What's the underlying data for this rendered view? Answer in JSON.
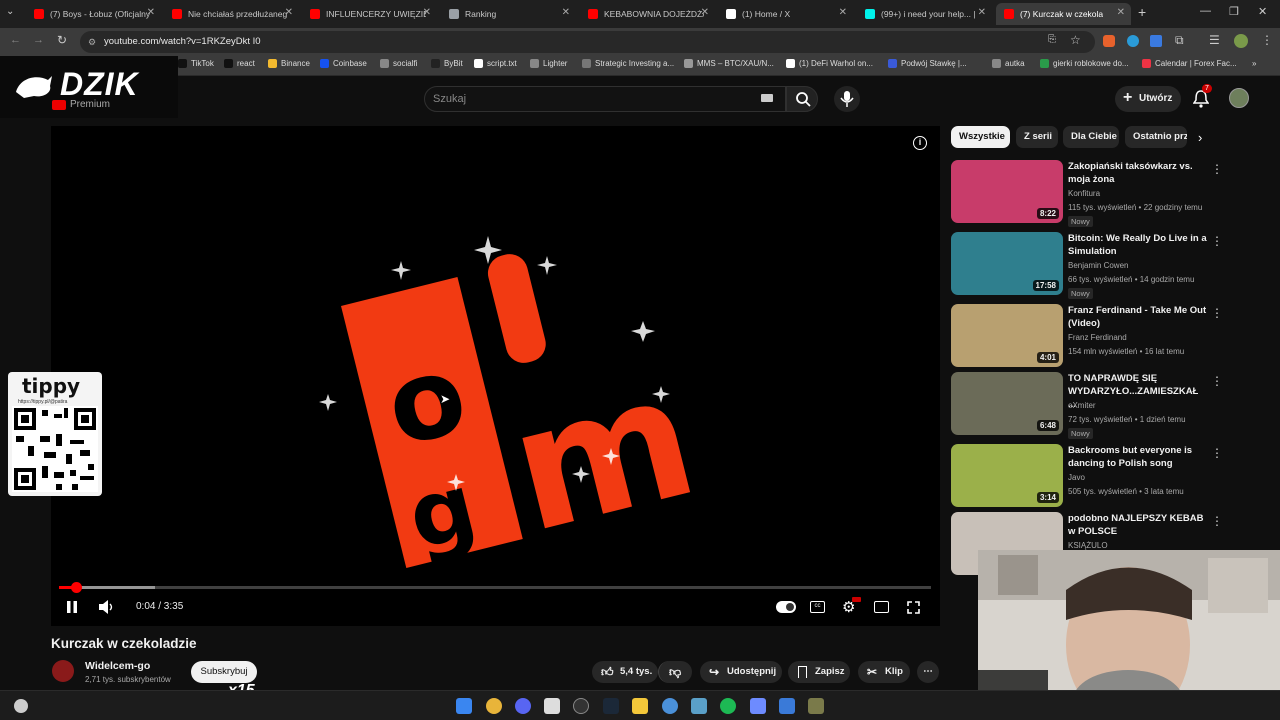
{
  "tabs": [
    {
      "title": "(7) Boys - Łobuz (Oficjalny",
      "color": "#ff0000",
      "active": false
    },
    {
      "title": "Nie chciałaś przedłużaneg",
      "color": "#ff0000",
      "active": false
    },
    {
      "title": "INFLUENCERZY UWIĘZIE",
      "color": "#ff0000",
      "active": false
    },
    {
      "title": "Ranking",
      "color": "#9aa0a6",
      "active": false
    },
    {
      "title": "KEBABOWNIA DOJEŻDŻA",
      "color": "#ff0000",
      "active": false
    },
    {
      "title": "(1) Home / X",
      "color": "#ffffff",
      "active": false
    },
    {
      "title": "(99+) i need your help... |",
      "color": "#00f2ea",
      "active": false
    },
    {
      "title": "(7) Kurczak w czekola",
      "color": "#ff0000",
      "active": true
    }
  ],
  "address": {
    "url": "youtube.com/watch?v=1RKZeyDkt I0"
  },
  "bookmarks": [
    "TikTok",
    "react",
    "Binance",
    "Coinbase",
    "socialfi",
    "ByBit",
    "script.txt",
    "Lighter",
    "Strategic Investing a...",
    "MMS – BTC/XAU/N...",
    "(1) DeFi Warhol on...",
    "Podwój Stawkę |...",
    "autka",
    "gierki roblokowe do...",
    "Calendar | Forex Fac..."
  ],
  "overlay": {
    "dzik": "DZIK",
    "premium": "Premium",
    "tippy": "tippy",
    "tippy_url": "https://tippy.pl/@patira",
    "x15": "x15"
  },
  "header": {
    "search_placeholder": "Szukaj",
    "create_label": "Utwórz",
    "notif_count": "7"
  },
  "player": {
    "time": "0:04 / 3:35",
    "progress": 0.019,
    "buffered": 0.11
  },
  "video": {
    "title": "Kurczak w czekoladzie",
    "channel": "Widelcem-go",
    "subs": "2,71 tys. subskrybentów",
    "subscribe": "Subskrybuj",
    "likes": "5,4 tys.",
    "share": "Udostępnij",
    "save": "Zapisz",
    "clip": "Klip"
  },
  "chips": [
    "Wszystkie",
    "Z serii",
    "Dla Ciebie",
    "Ostatnio prz"
  ],
  "related": [
    {
      "title": "Zakopiański taksówkarz vs. moja żona",
      "channel": "Konfitura",
      "meta": "115 tys. wyświetleń • 22 godziny temu",
      "badge": "Nowy",
      "duration": "8:22",
      "thumb": "#c83c6a"
    },
    {
      "title": "Bitcoin: We Really Do Live in a Simulation",
      "channel": "Benjamin Cowen",
      "meta": "66 tys. wyświetleń • 14 godzin temu",
      "badge": "Nowy",
      "duration": "17:58",
      "thumb": "#2f7f8e"
    },
    {
      "title": "Franz Ferdinand - Take Me Out (Video)",
      "channel": "Franz Ferdinand",
      "meta": "154 mln wyświetleń • 16 lat temu",
      "badge": "",
      "duration": "4:01",
      "thumb": "#b8a070"
    },
    {
      "title": "TO NAPRAWDĘ SIĘ WYDARZYŁO...ZAMIESZKAŁ ...",
      "channel": "eXmiter",
      "meta": "72 tys. wyświetleń • 1 dzień temu",
      "badge": "Nowy",
      "duration": "6:48",
      "thumb": "#6b6b58"
    },
    {
      "title": "Backrooms but everyone is dancing to Polish song",
      "channel": "Javo",
      "meta": "505 tys. wyświetleń • 3 lata temu",
      "badge": "",
      "duration": "3:14",
      "thumb": "#9bb04a"
    },
    {
      "title": "podobno NAJLEPSZY KEBAB w POLSCE",
      "channel": "KSIĄŻULO",
      "meta": "",
      "badge": "",
      "duration": "",
      "thumb": "#c8c0b8"
    }
  ]
}
